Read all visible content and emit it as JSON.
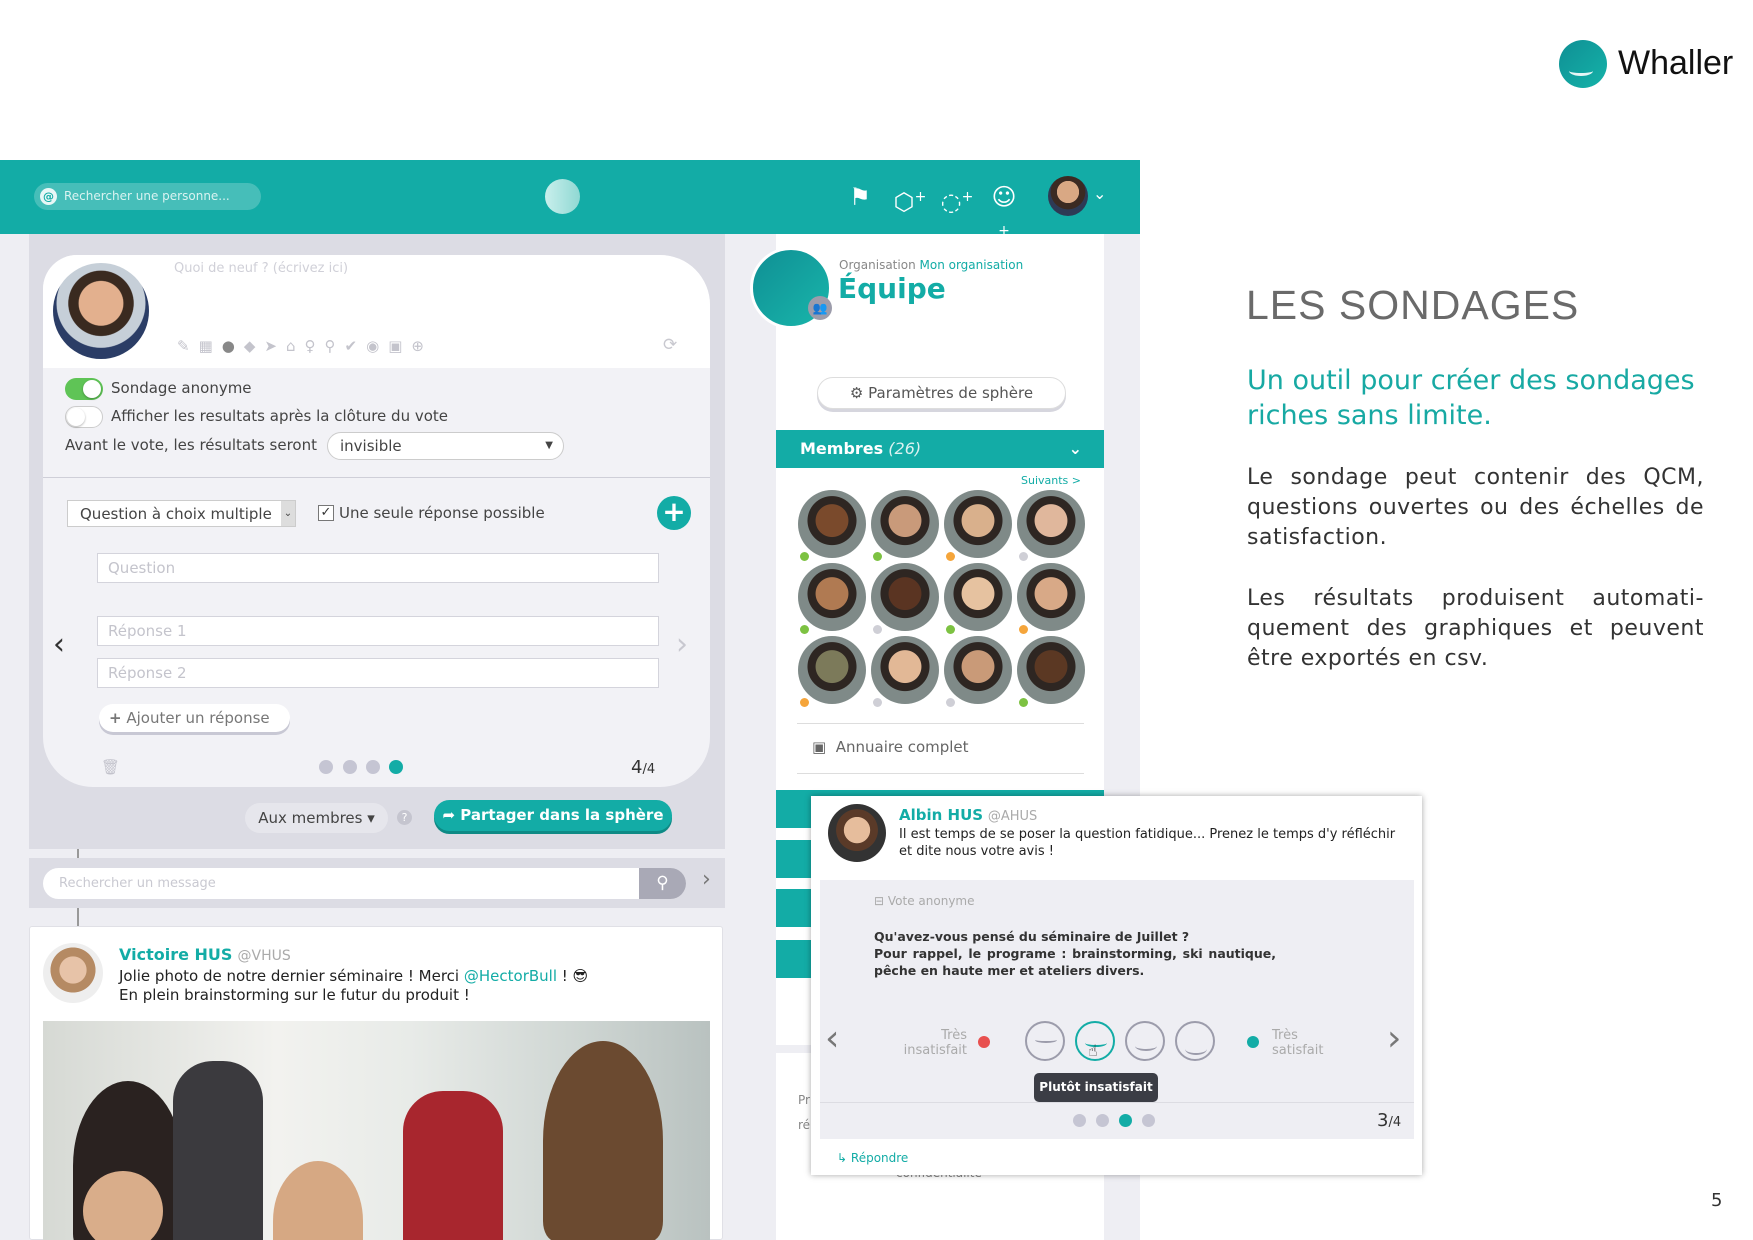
{
  "brand": {
    "name": "Whaller",
    "color": "#13aca6"
  },
  "slide": {
    "title": "LES SONDAGES",
    "subtitle_lines": [
      "Un outil pour créer des sondages",
      "riches sans limite."
    ],
    "paragraph1": "Le sondage peut contenir des QCM, questions ouvertes ou des échelles de satisfaction.",
    "paragraph2": "Les résultats produisent automati-quement des graphiques et peuvent être exportés en csv.",
    "page_number": "5"
  },
  "topbar": {
    "search_placeholder": "Rechercher une personne...",
    "icons": [
      "flag-icon",
      "add-sphere-icon",
      "add-conversation-icon",
      "add-person-icon"
    ],
    "avatar_chevron": "⌄"
  },
  "composer": {
    "placeholder": "Quoi de neuf ? (écrivez ici)",
    "toolbar_icons": [
      "paperclip-icon",
      "calendar-icon",
      "poll-icon",
      "tag-icon",
      "send-icon",
      "home-icon",
      "bulb-icon",
      "location-icon",
      "check-icon",
      "eye-icon",
      "markdown-icon",
      "plus-circle-icon"
    ],
    "anonymous_label": "Sondage anonyme",
    "anonymous_on": true,
    "show_results_label": "Afficher les resultats après la clôture du vote",
    "show_results_on": false,
    "before_vote_label": "Avant le vote, les résultats seront",
    "before_vote_value": "invisible",
    "question_type": "Question à choix multiple",
    "single_answer_label": "Une seule réponse possible",
    "single_answer_checked": true,
    "question_placeholder": "Question",
    "answer1_placeholder": "Réponse 1",
    "answer2_placeholder": "Réponse 2",
    "add_answer_label": "Ajouter un réponse",
    "page_current": "4",
    "page_total": "/4",
    "audience": "Aux membres ▾",
    "help": "?",
    "share_label": "Partager dans la sphère"
  },
  "message_search": {
    "placeholder": "Rechercher un message"
  },
  "post": {
    "author": "Victoire HUS",
    "handle": "@VHUS",
    "text_before": "Jolie photo de notre dernier séminaire ! Merci ",
    "mention": "@HectorBull",
    "text_after": " ! 😎",
    "line2": "En plein brainstorming sur le futur du produit !"
  },
  "sphere": {
    "org_label": "Organisation",
    "org_name": "Mon organisation",
    "name": "Équipe",
    "settings_label": "Paramètres de sphère",
    "members_label": "Membres",
    "members_count": "(26)",
    "next_label": "Suivants >",
    "directory_label": "Annuaire complet",
    "members": [
      {
        "status": "#7dc242",
        "skin": "#7a4a2c"
      },
      {
        "status": "#7dc242",
        "skin": "#c99a7a"
      },
      {
        "status": "#f5a53b",
        "skin": "#d9b08c"
      },
      {
        "status": "#cfcfd6",
        "skin": "#e0b79c"
      },
      {
        "status": "#7dc242",
        "skin": "#b07a52"
      },
      {
        "status": "#cfcfd6",
        "skin": "#5a3422"
      },
      {
        "status": "#7dc242",
        "skin": "#e6c2a0"
      },
      {
        "status": "#f5a53b",
        "skin": "#d8a987"
      },
      {
        "status": "#f5a53b",
        "skin": "#7c7a5a"
      },
      {
        "status": "#cfcfd6",
        "skin": "#e2b896"
      },
      {
        "status": "#cfcfd6",
        "skin": "#c99a78"
      },
      {
        "status": "#7dc242",
        "skin": "#5b3823"
      }
    ],
    "lower_card_lines": [
      "Pr",
      "ré",
      "confidentialité"
    ]
  },
  "poll_post": {
    "author": "Albin HUS",
    "handle": "@AHUS",
    "text": "Il est temps de se poser la question fatidique... Prenez le temps d'y réfléchir et dite nous votre avis !",
    "vote_label": "Vote anonyme",
    "question_line1": "Qu'avez-vous pensé du séminaire de Juillet ?",
    "question_line2": "Pour rappel, le programe : brainstorming, ski nautique, pêche en haute mer et ateliers divers.",
    "low_label": "Très insatisfait",
    "high_label": "Très satisfait",
    "low_color": "#e8504f",
    "scale_count": 4,
    "selected_index": 1,
    "tooltip": "Plutôt insatisfait",
    "page_current": "3",
    "page_total": "/4",
    "reply_label": "Répondre"
  }
}
